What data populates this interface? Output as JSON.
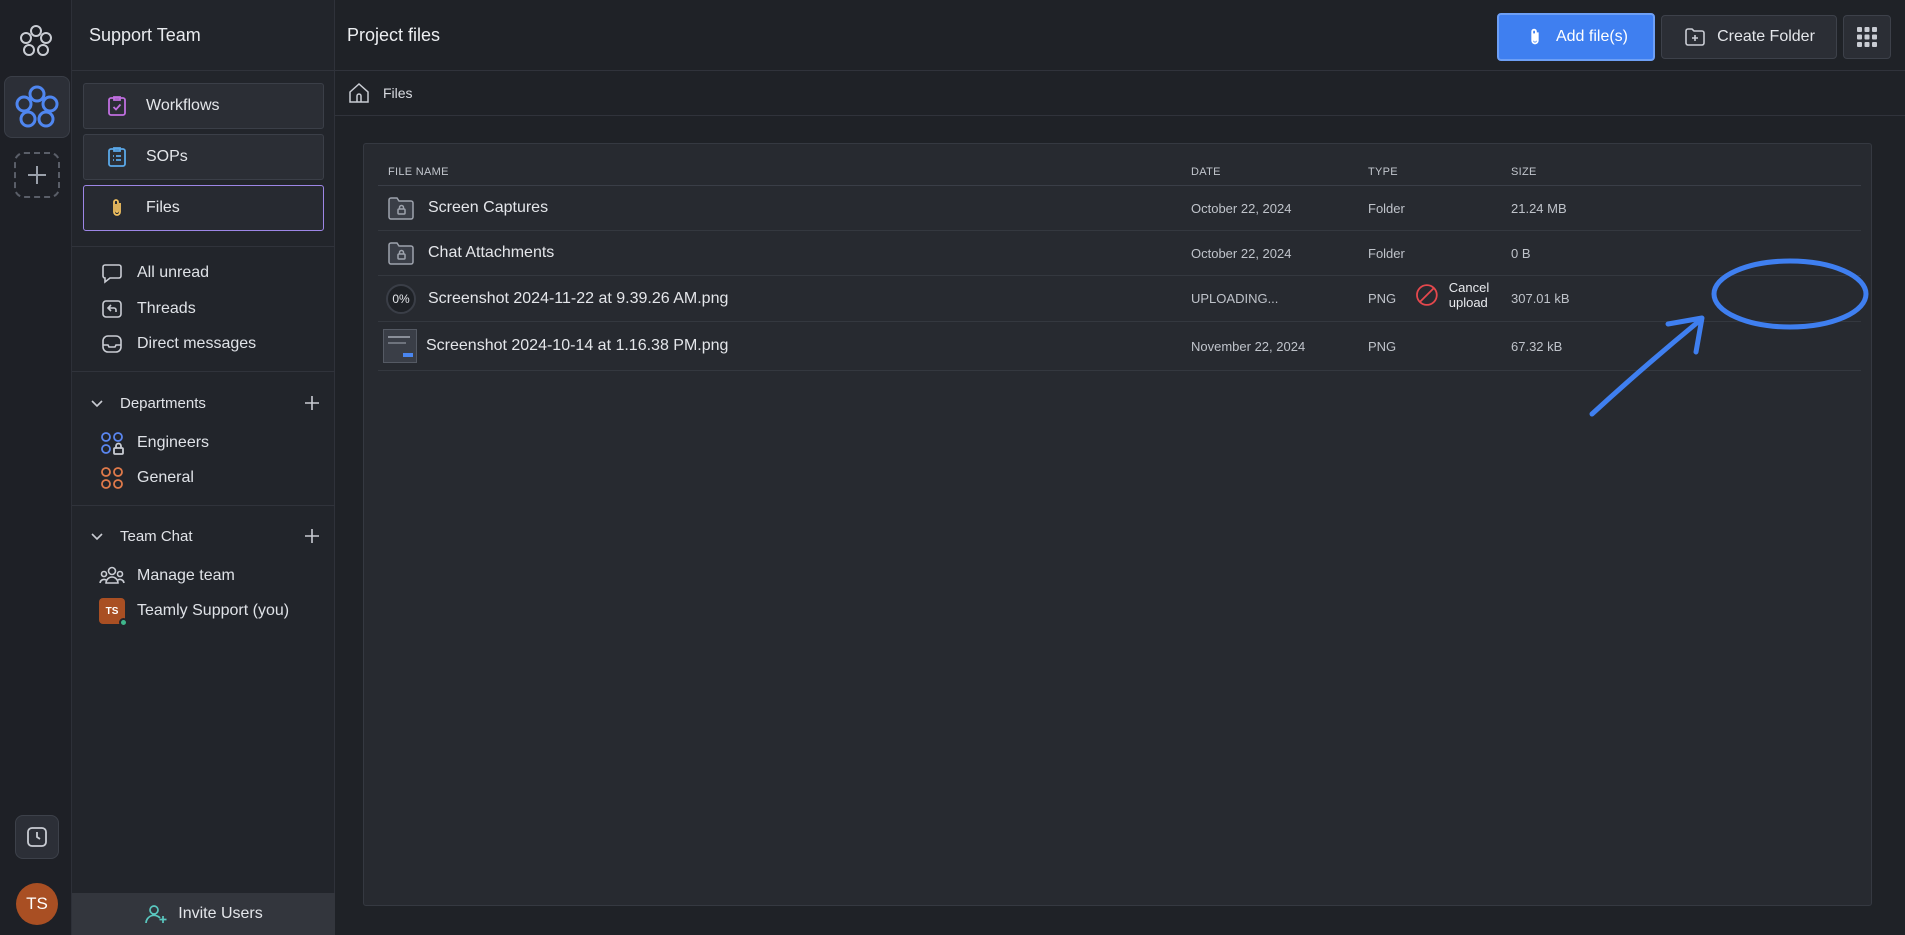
{
  "rail": {
    "avatar_initials": "TS"
  },
  "sidebar": {
    "team_name": "Support Team",
    "nav": [
      {
        "label": "Workflows",
        "icon": "workflow-icon",
        "color": "#c06fe0"
      },
      {
        "label": "SOPs",
        "icon": "sops-icon",
        "color": "#5aa8e8"
      },
      {
        "label": "Files",
        "icon": "paperclip-icon",
        "color": "#f0c060",
        "active": true
      }
    ],
    "items": [
      {
        "label": "All unread",
        "icon": "chat-bubble-icon"
      },
      {
        "label": "Threads",
        "icon": "threads-icon"
      },
      {
        "label": "Direct messages",
        "icon": "inbox-icon"
      }
    ],
    "departments": {
      "title": "Departments",
      "items": [
        {
          "label": "Engineers",
          "icon": "locked-group-icon"
        },
        {
          "label": "General",
          "icon": "group-icon"
        }
      ]
    },
    "team_chat": {
      "title": "Team Chat",
      "items": [
        {
          "label": "Manage team",
          "icon": "team-icon"
        },
        {
          "label": "Teamly Support (you)",
          "avatar": "TS"
        }
      ]
    },
    "invite_label": "Invite Users"
  },
  "main": {
    "title": "Project files",
    "add_files_label": "Add file(s)",
    "create_folder_label": "Create Folder",
    "breadcrumb": "Files",
    "columns": {
      "name": "FILE NAME",
      "date": "DATE",
      "type": "TYPE",
      "size": "SIZE"
    },
    "rows": [
      {
        "name": "Screen Captures",
        "date": "October 22, 2024",
        "type": "Folder",
        "size": "21.24 MB",
        "icon": "locked-folder-icon"
      },
      {
        "name": "Chat Attachments",
        "date": "October 22, 2024",
        "type": "Folder",
        "size": "0 B",
        "icon": "locked-folder-icon"
      },
      {
        "name": "Screenshot 2024-11-22 at 9.39.26 AM.png",
        "date": "UPLOADING...",
        "type": "PNG",
        "size": "307.01 kB",
        "progress": "0%",
        "cancel_label": "Cancel upload"
      },
      {
        "name": "Screenshot 2024-10-14 at 1.16.38 PM.png",
        "date": "November 22, 2024",
        "type": "PNG",
        "size": "67.32 kB",
        "icon": "image-thumbnail"
      }
    ]
  },
  "colors": {
    "accent": "#3f7ff0",
    "annotation": "#3f7ff0",
    "cancel_icon": "#e5484d"
  }
}
